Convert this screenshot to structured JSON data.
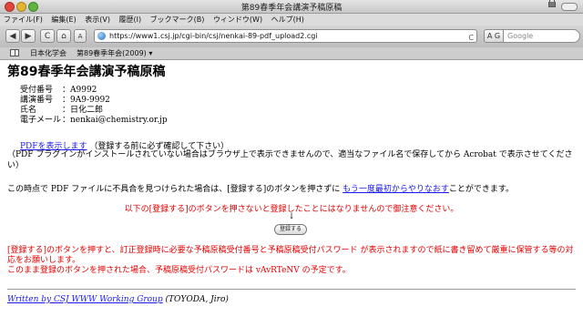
{
  "window": {
    "title": "第89春季年会講演予稿原稿"
  },
  "menu": [
    "ファイル(F)",
    "編集(E)",
    "表示(V)",
    "履歴(I)",
    "ブックマーク(B)",
    "ウィンドウ(W)",
    "ヘルプ(H)"
  ],
  "toolbar": {
    "back": "◀",
    "forward": "▶",
    "reload": "C",
    "home": "⌂",
    "text_smaller": "A",
    "text_larger": "A",
    "url": "https://www1.csj.jp/cgi-bin/csj/nenkai-89-pdf_upload2.cgi",
    "rss": "C",
    "search_engine": "A G",
    "search_placeholder": "Google"
  },
  "bookmarks": [
    "日本化学会",
    "第89春季年会(2009) ▾"
  ],
  "page": {
    "title": "第89春季年会講演予稿原稿",
    "fields": [
      {
        "label": "受付番号",
        "value": "：A9992"
      },
      {
        "label": "講演番号",
        "value": "：9A9-9992"
      },
      {
        "label": "氏名",
        "value": "：日化二郎"
      },
      {
        "label": "電子メール",
        "value": "：nenkai@chemistry.or.jp"
      }
    ],
    "pdf_link": "PDFを表示します",
    "pdf_note": "（登録する前に必ず確認して下さい）",
    "plugin_note": "（PDF プラグインがインストールされていない場合はブラウザ上で表示できませんので、適当なファイル名で保存してから Acrobat で表示させてください）",
    "retry_before": "この時点で PDF ファイルに不具合を見つけられた場合は、[登録する]のボタンを押さずに ",
    "retry_link": "もう一度最初からやりなおす",
    "retry_after": "ことができます。",
    "warning1": "以下の[登録する]のボタンを押さないと登録したことにはなりませんので御注意ください。",
    "arrow": "↓",
    "register_button": "登録する",
    "warning2_line1": "[登録する]のボタンを押すと、訂正登録時に必要な予稿原稿受付番号と予稿原稿受付パスワード が表示されますので紙に書き留めて厳重に保管する等の対応をお願いします。",
    "warning2_line2": "このまま登録のボタンを押された場合、予稿原稿受付パスワードは vAvRTeNV の予定です。",
    "footer_link": "Written by CSJ WWW Working Group",
    "footer_author": " (TOYODA, Jiro)"
  }
}
